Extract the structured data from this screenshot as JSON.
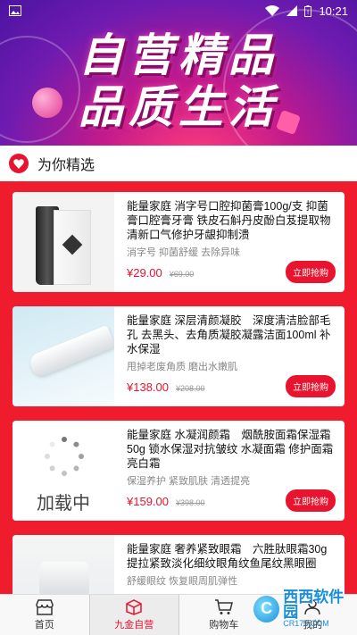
{
  "status_bar": {
    "time": "10:21"
  },
  "banner": {
    "line1": "自营精品",
    "line2": "品质生活"
  },
  "section": {
    "title": "为你精选"
  },
  "products": [
    {
      "name": "能量家庭 消字号口腔抑菌膏100g/支 抑菌膏口腔膏牙膏 铁皮石斛丹皮酚白芨提取物 清新口气修护牙龈抑制溃",
      "tags": "消字号 抑菌舒缓 去除异味",
      "price": "¥29.00",
      "old_price": "¥69.00",
      "button": "立即抢购"
    },
    {
      "name": "能量家庭 深层清颜凝胶　深度清洁脸部毛孔 去黑头、去角质凝胶凝露洁面100ml 补水保湿",
      "tags": "甩掉老废角质 磨出水嫩肌",
      "price": "¥138.00",
      "old_price": "¥208.00",
      "button": "立即抢购"
    },
    {
      "name": "能量家庭 水凝润颜霜　烟酰胺面霜保湿霜50g 锁水保湿对抗皱纹 水凝面霜 修护面霜亮白霜",
      "tags": "保湿养护 紧致肌肤 清透提亮",
      "price": "¥159.00",
      "old_price": "¥398.00",
      "button": "立即抢购",
      "thumb_loading_text": "加载中"
    },
    {
      "name": "能量家庭 奢养紧致眼霜　六胜肽眼霜30g 提拉紧致淡化细纹眼角纹鱼尾纹黑眼圈",
      "tags": "舒缓眼纹 恢复眼周肌弹性",
      "price": "",
      "old_price": "",
      "button": ""
    }
  ],
  "bottom_nav": [
    {
      "label": "首页",
      "icon": "store-icon"
    },
    {
      "label": "九金自营",
      "icon": "box-icon",
      "active": true
    },
    {
      "label": "购物车",
      "icon": "cart-icon"
    },
    {
      "label": "我的",
      "icon": "user-icon"
    }
  ],
  "watermark": {
    "cn": "西西软件园",
    "en": "CR173.COM"
  },
  "colors": {
    "accent": "#e8132f",
    "list_bg": "#ee1c2c",
    "banner": "#6f1bb0"
  }
}
